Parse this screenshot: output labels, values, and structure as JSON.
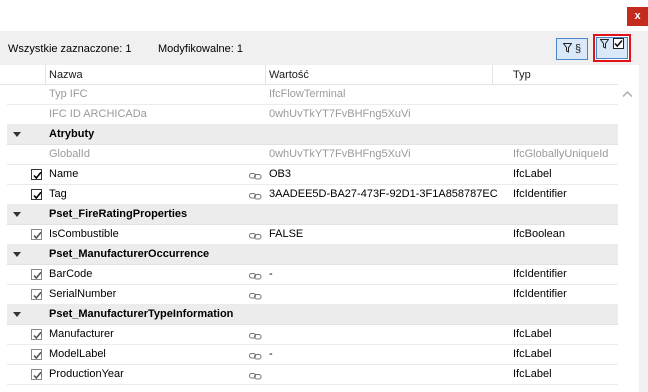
{
  "window": {
    "close_label": "x"
  },
  "toolbar": {
    "all_selected": "Wszystkie zaznaczone: 1",
    "modifiable": "Modyfikowalne: 1",
    "filter_section_label": "§",
    "filter_checked_label": "☑"
  },
  "columns": {
    "name": "Nazwa",
    "value": "Wartość",
    "type": "Typ"
  },
  "rows": [
    {
      "kind": "info",
      "name": "Typ IFC",
      "value": "IfcFlowTerminal",
      "type": ""
    },
    {
      "kind": "info",
      "name": "IFC ID ARCHICADa",
      "value": "0whUvTkYT7FvBHFng5XuVi",
      "type": ""
    },
    {
      "kind": "group",
      "name": "Atrybuty"
    },
    {
      "kind": "readonly",
      "name": "GlobalId",
      "value": "0whUvTkYT7FvBHFng5XuVi",
      "type": "IfcGloballyUniqueId"
    },
    {
      "kind": "prop",
      "checked": true,
      "name": "Name",
      "value": "OB3",
      "type": "IfcLabel"
    },
    {
      "kind": "prop",
      "checked": true,
      "name": "Tag",
      "value": "3AADEE5D-BA27-473F-92D1-3F1A858787EC",
      "type": "IfcIdentifier"
    },
    {
      "kind": "group",
      "name": "Pset_FireRatingProperties"
    },
    {
      "kind": "prop",
      "checked": true,
      "dim": true,
      "name": "IsCombustible",
      "value": "FALSE",
      "type": "IfcBoolean"
    },
    {
      "kind": "group",
      "name": "Pset_ManufacturerOccurrence"
    },
    {
      "kind": "prop",
      "checked": true,
      "dim": true,
      "name": "BarCode",
      "value": "-",
      "type": "IfcIdentifier"
    },
    {
      "kind": "prop",
      "checked": true,
      "dim": true,
      "name": "SerialNumber",
      "value": "",
      "type": "IfcIdentifier"
    },
    {
      "kind": "group",
      "name": "Pset_ManufacturerTypeInformation"
    },
    {
      "kind": "prop",
      "checked": true,
      "dim": true,
      "name": "Manufacturer",
      "value": "",
      "type": "IfcLabel"
    },
    {
      "kind": "prop",
      "checked": true,
      "dim": true,
      "name": "ModelLabel",
      "value": "-",
      "type": "IfcLabel"
    },
    {
      "kind": "prop",
      "checked": true,
      "dim": true,
      "name": "ProductionYear",
      "value": "",
      "type": "IfcLabel"
    }
  ],
  "colors": {
    "close": "#c42b1c",
    "highlight": "#e0141a",
    "button_border": "#4b86c8",
    "group_bg": "#ececec",
    "muted_text": "#9a9a9a"
  }
}
